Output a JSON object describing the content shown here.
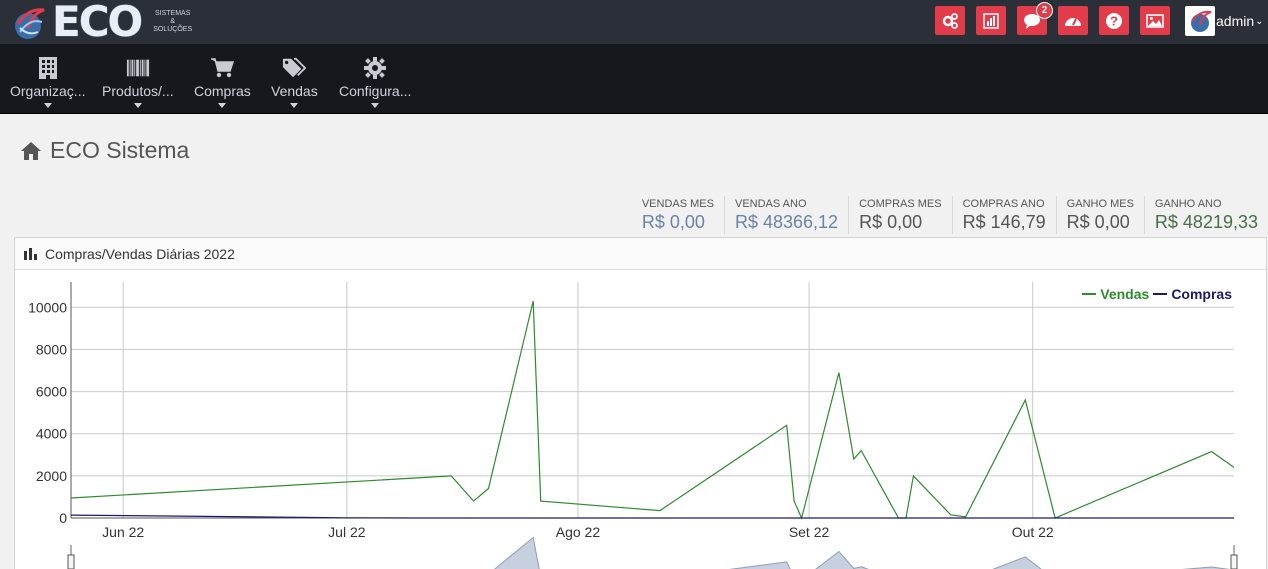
{
  "app": {
    "logo_text": "ECO",
    "logo_subtitle": [
      "SISTEMAS",
      "&",
      "SOLUÇÕES"
    ]
  },
  "topbar": {
    "icons": [
      {
        "name": "settings-icon"
      },
      {
        "name": "report-icon"
      },
      {
        "name": "chat-icon",
        "badge": "2"
      },
      {
        "name": "dashboard-icon"
      },
      {
        "name": "help-icon"
      },
      {
        "name": "image-icon"
      }
    ],
    "user": "admin",
    "accent": "#e23b4a"
  },
  "menu": [
    {
      "label": "Organizaç...",
      "icon": "building-icon"
    },
    {
      "label": "Produtos/...",
      "icon": "barcode-icon"
    },
    {
      "label": "Compras",
      "icon": "cart-icon"
    },
    {
      "label": "Vendas",
      "icon": "tags-icon"
    },
    {
      "label": "Configura...",
      "icon": "gear-icon"
    }
  ],
  "page": {
    "title": "ECO Sistema",
    "icon": "home-icon"
  },
  "stats": [
    {
      "label": "VENDAS MES",
      "value": "R$ 0,00"
    },
    {
      "label": "VENDAS ANO",
      "value": "R$ 48366,12"
    },
    {
      "label": "COMPRAS MES",
      "value": "R$ 0,00"
    },
    {
      "label": "COMPRAS ANO",
      "value": "R$ 146,79"
    },
    {
      "label": "GANHO MES",
      "value": "R$ 0,00"
    },
    {
      "label": "GANHO ANO",
      "value": "R$ 48219,33"
    }
  ],
  "panel": {
    "title": "Compras/Vendas Diárias 2022",
    "icon": "bar-chart-icon"
  },
  "chart_data": {
    "type": "line",
    "x_type": "date",
    "xlim": [
      "2022-05-25",
      "2022-10-28"
    ],
    "ylim": [
      0,
      11200
    ],
    "yticks": [
      0,
      2000,
      4000,
      6000,
      8000,
      10000
    ],
    "xticks": [
      {
        "date": "2022-06-01",
        "label": "Jun 22"
      },
      {
        "date": "2022-07-01",
        "label": "Jul 22"
      },
      {
        "date": "2022-08-01",
        "label": "Ago 22"
      },
      {
        "date": "2022-09-01",
        "label": "Set 22"
      },
      {
        "date": "2022-10-01",
        "label": "Out 22"
      }
    ],
    "grid": true,
    "legend_position": "top-right",
    "series": [
      {
        "name": "Vendas",
        "color": "#2e8b2e",
        "points": [
          [
            "2022-05-25",
            950
          ],
          [
            "2022-07-15",
            2000
          ],
          [
            "2022-07-18",
            800
          ],
          [
            "2022-07-20",
            1400
          ],
          [
            "2022-07-26",
            10300
          ],
          [
            "2022-07-27",
            800
          ],
          [
            "2022-08-12",
            350
          ],
          [
            "2022-08-29",
            4400
          ],
          [
            "2022-08-30",
            800
          ],
          [
            "2022-08-31",
            0
          ],
          [
            "2022-09-05",
            6900
          ],
          [
            "2022-09-07",
            2800
          ],
          [
            "2022-09-08",
            3200
          ],
          [
            "2022-09-13",
            0
          ],
          [
            "2022-09-14",
            0
          ],
          [
            "2022-09-15",
            2000
          ],
          [
            "2022-09-20",
            150
          ],
          [
            "2022-09-22",
            50
          ],
          [
            "2022-09-30",
            5600
          ],
          [
            "2022-10-04",
            0
          ],
          [
            "2022-10-25",
            3150
          ],
          [
            "2022-10-28",
            2400
          ]
        ]
      },
      {
        "name": "Compras",
        "color": "#1a1a6e",
        "points": [
          [
            "2022-05-25",
            140
          ],
          [
            "2022-07-01",
            10
          ],
          [
            "2022-07-10",
            0
          ],
          [
            "2022-10-28",
            0
          ]
        ]
      }
    ]
  }
}
